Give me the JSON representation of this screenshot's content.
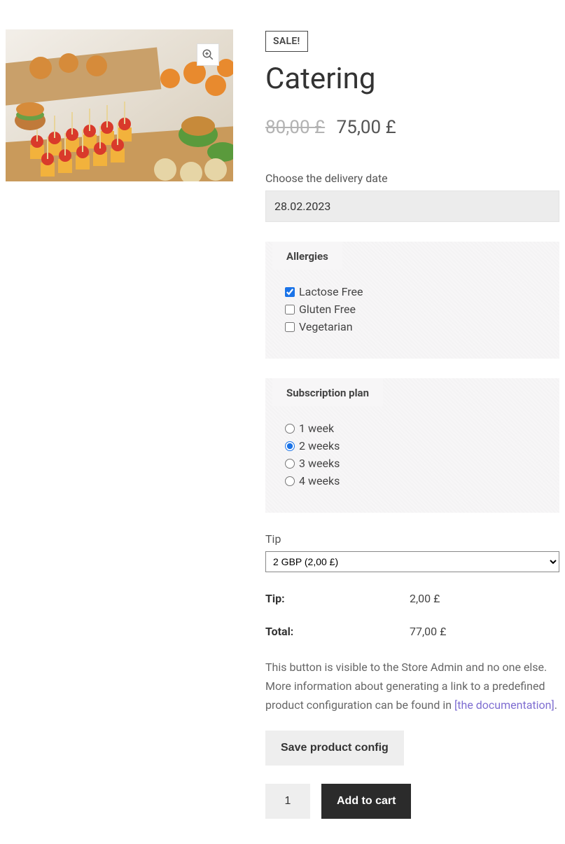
{
  "sale_badge": "SALE!",
  "title": "Catering",
  "price": {
    "old": "80,00 £",
    "new": "75,00 £"
  },
  "delivery": {
    "label": "Choose the delivery date",
    "value": "28.02.2023"
  },
  "allergies": {
    "title": "Allergies",
    "items": [
      {
        "label": "Lactose Free",
        "checked": true
      },
      {
        "label": "Gluten Free",
        "checked": false
      },
      {
        "label": "Vegetarian",
        "checked": false
      }
    ]
  },
  "subscription": {
    "title": "Subscription plan",
    "items": [
      {
        "label": "1 week",
        "checked": false
      },
      {
        "label": "2 weeks",
        "checked": true
      },
      {
        "label": "3 weeks",
        "checked": false
      },
      {
        "label": "4 weeks",
        "checked": false
      }
    ]
  },
  "tip": {
    "label": "Tip",
    "selected": "2 GBP (2,00 £)"
  },
  "summary": {
    "tip_label": "Tip:",
    "tip_value": "2,00 £",
    "total_label": "Total:",
    "total_value": "77,00 £"
  },
  "admin_note": {
    "text_before": "This button is visible to the Store Admin and no one else. More information about generating a link to a predefined product configuration can be found in ",
    "link_text": "[the documentation]",
    "text_after": "."
  },
  "buttons": {
    "save_config": "Save product config",
    "add_to_cart": "Add to cart"
  },
  "quantity": "1"
}
